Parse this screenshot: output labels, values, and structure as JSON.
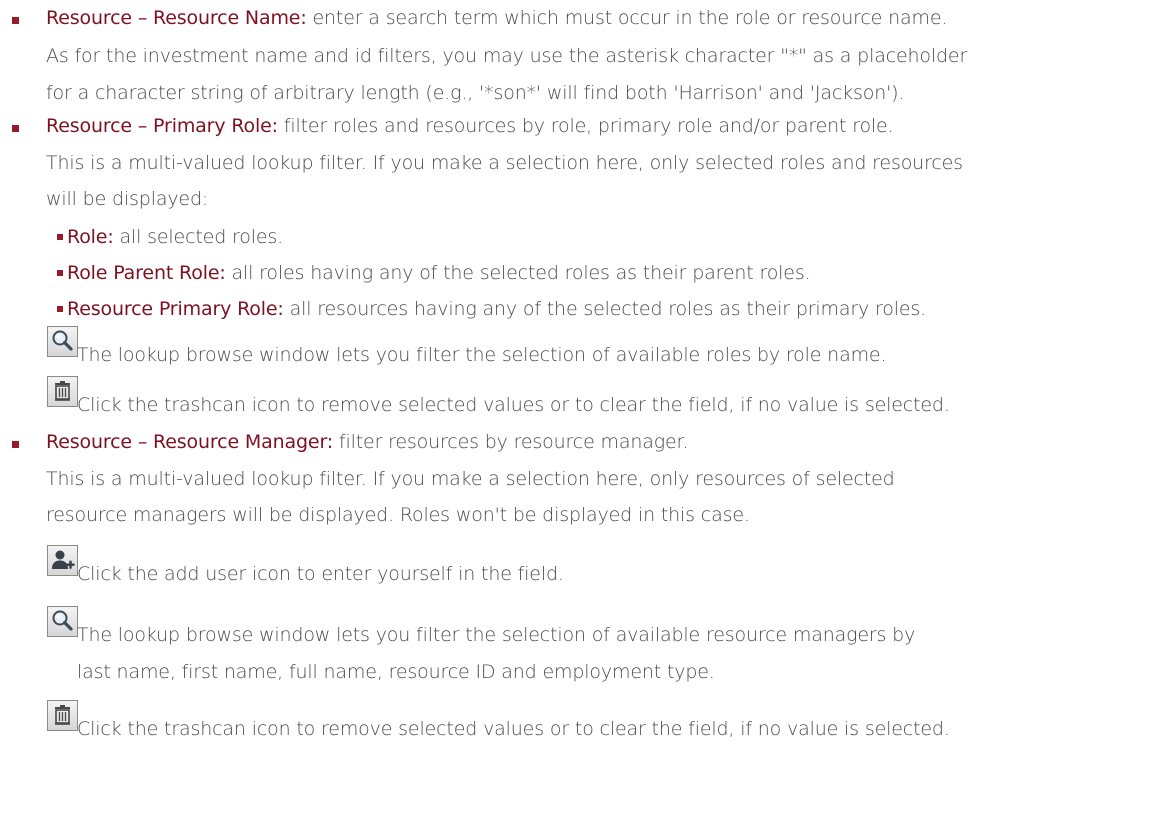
{
  "accent_color": "#7d1122",
  "items": [
    {
      "term": "Resource – Resource Name:",
      "text": " enter a search term which must occur in the role or resource name.",
      "lines": [
        "As for the investment name and id filters, you may use the asterisk character \"*\" as a placeholder",
        "for a character string of arbitrary length (e.g., '*son*' will find both 'Harrison' and 'Jackson')."
      ]
    },
    {
      "term": "Resource – Primary Role:",
      "text": " filter roles and resources by role, primary role and/or parent role.",
      "lines": [
        "This is a multi-valued lookup filter. If you make a selection here, only selected roles and resources",
        "will be displayed:"
      ],
      "sub_items": [
        {
          "term": "Role:",
          "text": " all selected roles."
        },
        {
          "term": "Role Parent Role:",
          "text": " all roles having any of the selected roles as their parent roles."
        },
        {
          "term": "Resource Primary Role:",
          "text": " all resources having any of the selected roles as their primary roles."
        }
      ],
      "icons": [
        {
          "icon": "magnifier-icon",
          "text": "The lookup browse window lets you filter the selection of available roles by role name."
        },
        {
          "icon": "trashcan-icon",
          "text": "Click the trashcan icon to remove selected values or to clear the field, if no value is selected."
        }
      ]
    },
    {
      "term": "Resource – Resource Manager:",
      "text": " filter resources by resource manager.",
      "lines": [
        "This is a multi-valued lookup filter. If you make a selection here, only resources of selected",
        "resource managers will be displayed. Roles won't be displayed in this case."
      ],
      "icons": [
        {
          "icon": "add-user-icon",
          "text": "Click the add user icon to enter yourself in the field."
        },
        {
          "icon": "magnifier-icon",
          "text": "The lookup browse window lets you filter the selection of available resource managers by",
          "continuation": "last name, first name, full name, resource ID and employment type."
        },
        {
          "icon": "trashcan-icon",
          "text": "Click the trashcan icon to remove selected values or to clear the field, if no value is selected."
        }
      ]
    }
  ]
}
